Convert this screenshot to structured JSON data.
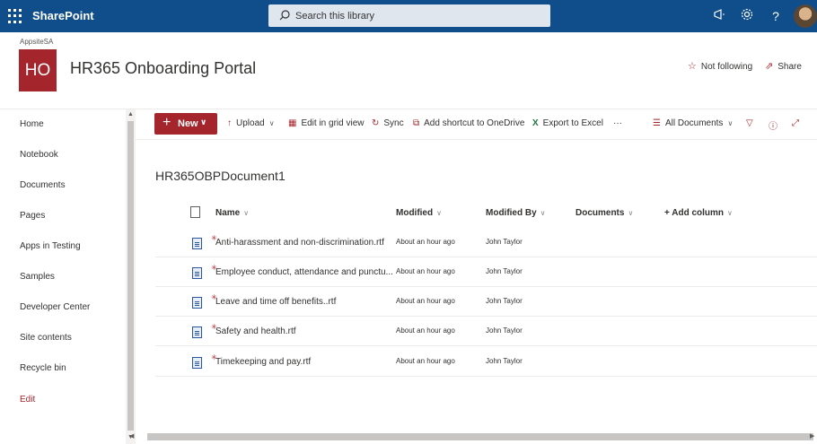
{
  "suitebar": {
    "app_name": "SharePoint",
    "search_placeholder": "Search this library",
    "icons": [
      "megaphone-icon",
      "gear-icon",
      "help-icon"
    ],
    "help_glyph": "?"
  },
  "header": {
    "site_small": "AppsiteSA",
    "logo_text": "HO",
    "site_title": "HR365 Onboarding Portal",
    "follow_label": "Not following",
    "share_label": "Share",
    "accent": "#a4262c"
  },
  "nav": {
    "items": [
      "Home",
      "Notebook",
      "Documents",
      "Pages",
      "Apps in Testing",
      "Samples",
      "Developer Center",
      "Site contents",
      "Recycle bin"
    ],
    "edit_label": "Edit"
  },
  "commands": {
    "new": "New",
    "upload": "Upload",
    "grid": "Edit in grid view",
    "sync": "Sync",
    "shortcut": "Add shortcut to OneDrive",
    "excel": "Export to Excel",
    "more": "···",
    "view": "All Documents"
  },
  "library": {
    "title": "HR365OBPDocument1",
    "columns": {
      "name": "Name",
      "modified": "Modified",
      "modified_by": "Modified By",
      "documents": "Documents",
      "add_column": "+ Add column"
    },
    "rows": [
      {
        "name": "Anti-harassment and non-discrimination.rtf",
        "modified": "About an hour ago",
        "modified_by": "John Taylor"
      },
      {
        "name": "Employee conduct, attendance and punctu...",
        "modified": "About an hour ago",
        "modified_by": "John Taylor"
      },
      {
        "name": "Leave and time off benefits..rtf",
        "modified": "About an hour ago",
        "modified_by": "John Taylor"
      },
      {
        "name": "Safety and health.rtf",
        "modified": "About an hour ago",
        "modified_by": "John Taylor"
      },
      {
        "name": "Timekeeping and pay.rtf",
        "modified": "About an hour ago",
        "modified_by": "John Taylor"
      }
    ]
  }
}
